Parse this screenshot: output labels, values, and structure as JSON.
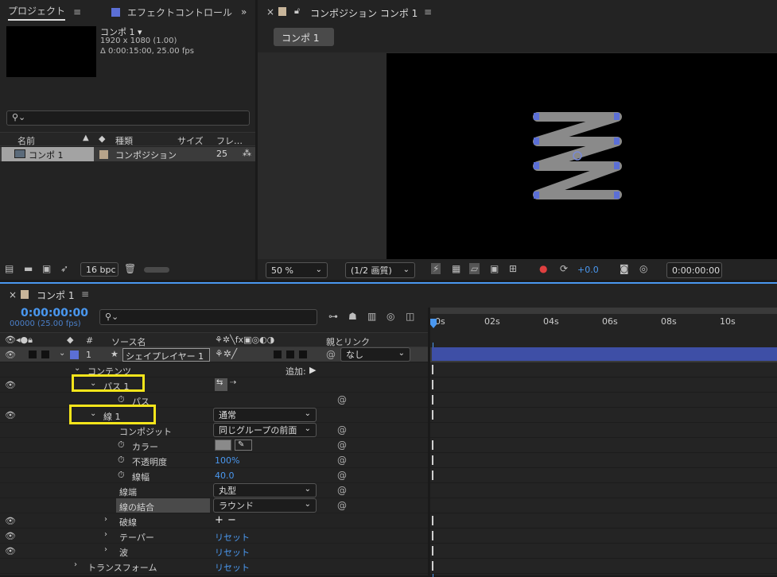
{
  "project_panel": {
    "tab_label": "プロジェクト",
    "effects_tab_label": "エフェクトコントロール",
    "comp_name": "コンポ 1 ▾",
    "comp_size": "1920 x 1080 (1.00)",
    "comp_duration": "Δ 0:00:15:00, 25.00 fps",
    "search_placeholder": "",
    "columns": [
      "名前",
      "種類",
      "サイズ",
      "フレ…"
    ],
    "items": [
      {
        "name": "コンポ 1",
        "type": "コンポジション",
        "frame_rate": "25"
      }
    ],
    "bpc_label": "16 bpc"
  },
  "composition_panel": {
    "title": "コンポジション コンポ 1",
    "tab_button": "コンポ 1",
    "zoom": "50 %",
    "resolution": "(1/2 画質)",
    "exposure": "+0.0",
    "timecode": "0:00:00:00"
  },
  "timeline": {
    "tab_label": "コンポ 1",
    "timecode": "0:00:00:00",
    "frame_info": "00000 (25.00 fps)",
    "search_placeholder": "",
    "col_number": "#",
    "col_source": "ソース名",
    "col_parent": "親とリンク",
    "ruler": [
      "0s",
      "02s",
      "04s",
      "06s",
      "08s",
      "10s"
    ],
    "layer": {
      "num": "1",
      "name": "シェイプレイヤー 1",
      "parent": "なし"
    },
    "rows": {
      "contents": "コンテンツ",
      "add": "追加:",
      "path1": "パス 1",
      "path": "パス",
      "stroke1": "線 1",
      "blend": "通常",
      "composite_label": "コンポジット",
      "composite_value": "同じグループの前面",
      "color_label": "カラー",
      "opacity_label": "不透明度",
      "opacity_value": "100%",
      "width_label": "線幅",
      "width_value": "40.0",
      "linecap_label": "線端",
      "linecap_value": "丸型",
      "linejoin_label": "線の結合",
      "linejoin_value": "ラウンド",
      "dashes": "破線",
      "taper": "テーパー",
      "wave": "波",
      "transform": "トランスフォーム",
      "reset": "リセット"
    }
  },
  "colors": {
    "accent_blue": "#4a98f0",
    "highlight": "#f5e51b",
    "label_purple": "#5b6fd6",
    "layer_bar": "#3e4fa6"
  }
}
